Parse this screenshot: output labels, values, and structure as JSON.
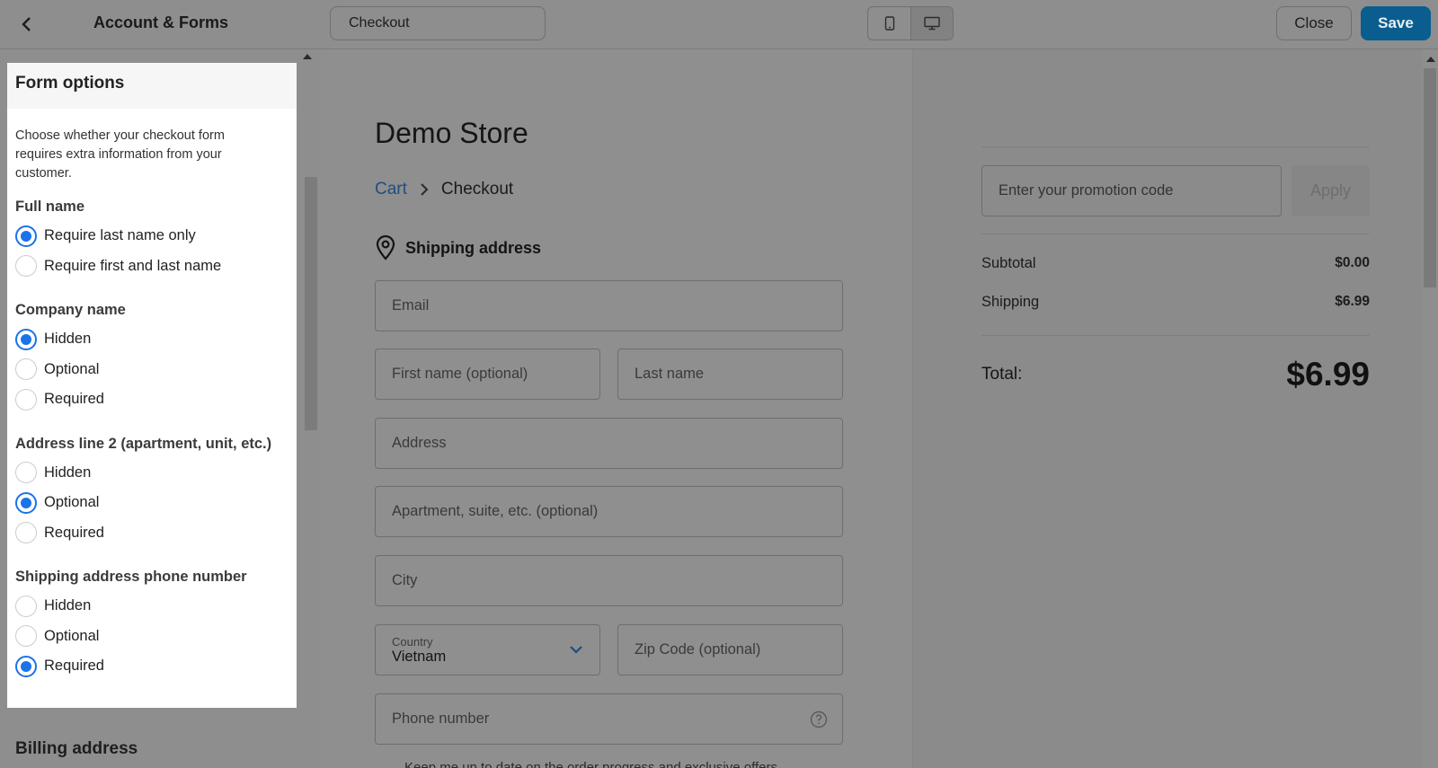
{
  "header": {
    "title": "Account & Forms",
    "page_selector": "Checkout",
    "close_label": "Close",
    "save_label": "Save",
    "icons": [
      "chevron-left-icon",
      "mobile-icon",
      "desktop-icon"
    ]
  },
  "form_options": {
    "title": "Form options",
    "description": "Choose whether your checkout form requires extra information from your customer.",
    "groups": [
      {
        "title": "Full name",
        "options": [
          "Require last name only",
          "Require first and last name"
        ],
        "selected": 0
      },
      {
        "title": "Company name",
        "options": [
          "Hidden",
          "Optional",
          "Required"
        ],
        "selected": 0
      },
      {
        "title": "Address line 2 (apartment, unit, etc.)",
        "options": [
          "Hidden",
          "Optional",
          "Required"
        ],
        "selected": 1
      },
      {
        "title": "Shipping address phone number",
        "options": [
          "Hidden",
          "Optional",
          "Required"
        ],
        "selected": 2
      }
    ],
    "next_section": "Billing address"
  },
  "preview": {
    "store_name": "Demo Store",
    "breadcrumb": {
      "cart": "Cart",
      "current": "Checkout"
    },
    "shipping_title": "Shipping address",
    "fields": {
      "email": "Email",
      "first_name": "First name (optional)",
      "last_name": "Last name",
      "address": "Address",
      "apartment": "Apartment, suite, etc. (optional)",
      "city": "City",
      "country_label": "Country",
      "country_value": "Vietnam",
      "zip": "Zip Code (optional)",
      "phone": "Phone number"
    },
    "keep_me_text": "Keep me up to date on the order progress and exclusive offers",
    "promo_placeholder": "Enter your promotion code",
    "apply_label": "Apply",
    "subtotal_label": "Subtotal",
    "subtotal_value": "$0.00",
    "shipping_label": "Shipping",
    "shipping_value": "$6.99",
    "total_label": "Total:",
    "total_value": "$6.99"
  },
  "colors": {
    "accent": "#1a73e8",
    "save": "#0a5d8f",
    "link": "#1f4d80"
  }
}
